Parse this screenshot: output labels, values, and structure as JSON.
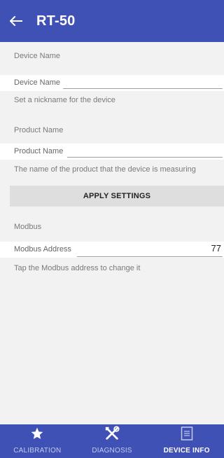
{
  "appbar": {
    "title": "RT-50",
    "back_icon": "arrow-left-icon"
  },
  "sections": {
    "device": {
      "header": "Device Name",
      "field_label": "Device Name",
      "field_value": "",
      "hint": "Set a nickname for the device"
    },
    "product": {
      "header": "Product Name",
      "field_label": "Product Name",
      "field_value": "",
      "hint": "The name of the product that the device is measuring"
    },
    "apply_button": "APPLY SETTINGS",
    "modbus": {
      "header": "Modbus",
      "field_label": "Modbus Address",
      "field_value": "77",
      "hint": "Tap the Modbus address to change it"
    }
  },
  "bottom_nav": {
    "items": [
      {
        "label": "CALIBRATION",
        "icon": "star-icon",
        "active": false
      },
      {
        "label": "DIAGNOSIS",
        "icon": "tools-icon",
        "active": false
      },
      {
        "label": "DEVICE INFO",
        "icon": "document-icon",
        "active": true
      }
    ]
  },
  "colors": {
    "primary": "#3f51b5",
    "background": "#f2f2f2"
  }
}
